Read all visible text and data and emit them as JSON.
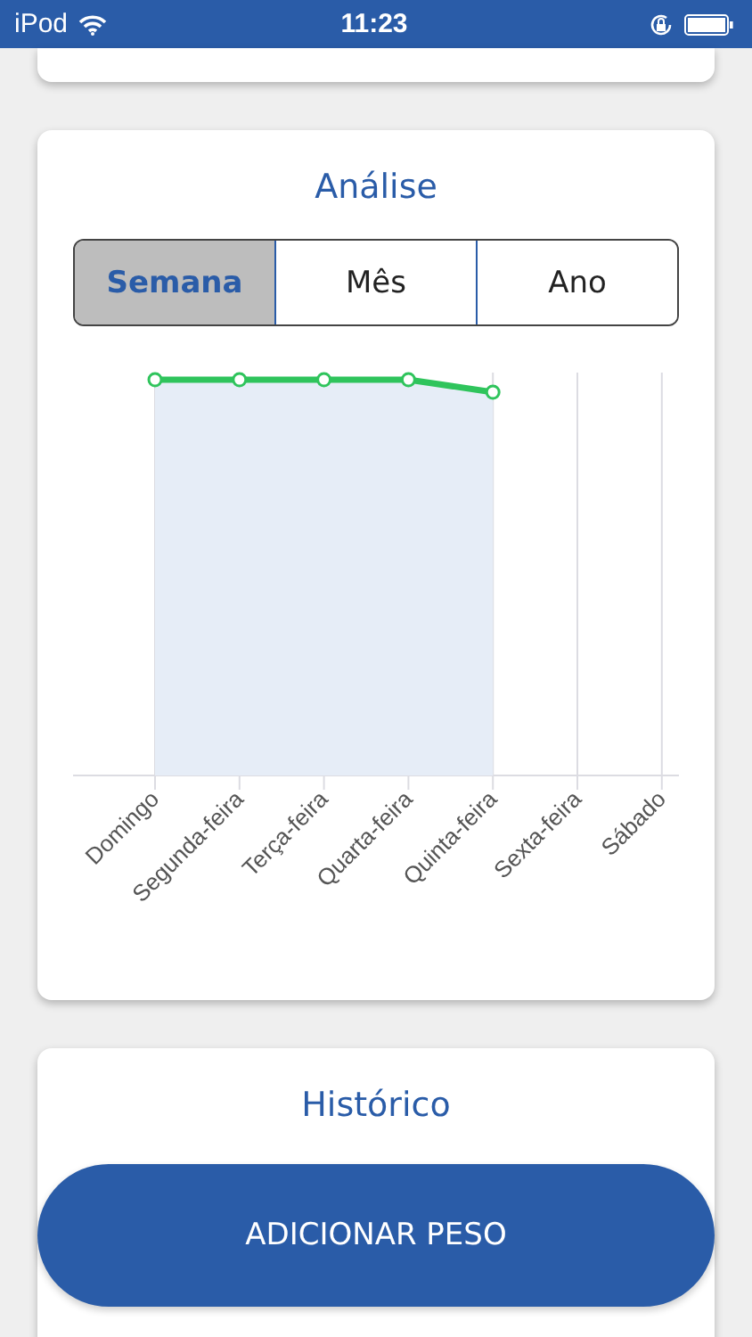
{
  "status_bar": {
    "carrier": "iPod",
    "time": "11:23"
  },
  "analysis": {
    "title": "Análise",
    "tabs": [
      {
        "label": "Semana",
        "selected": true
      },
      {
        "label": "Mês",
        "selected": false
      },
      {
        "label": "Ano",
        "selected": false
      }
    ],
    "chart": {
      "labels": [
        "Domingo",
        "Segunda-feira",
        "Terça-feira",
        "Quarta-feira",
        "Quinta-feira",
        "Sexta-feira",
        "Sábado"
      ]
    }
  },
  "history": {
    "title": "Histórico"
  },
  "add_button": {
    "label": "ADICIONAR PESO"
  }
}
